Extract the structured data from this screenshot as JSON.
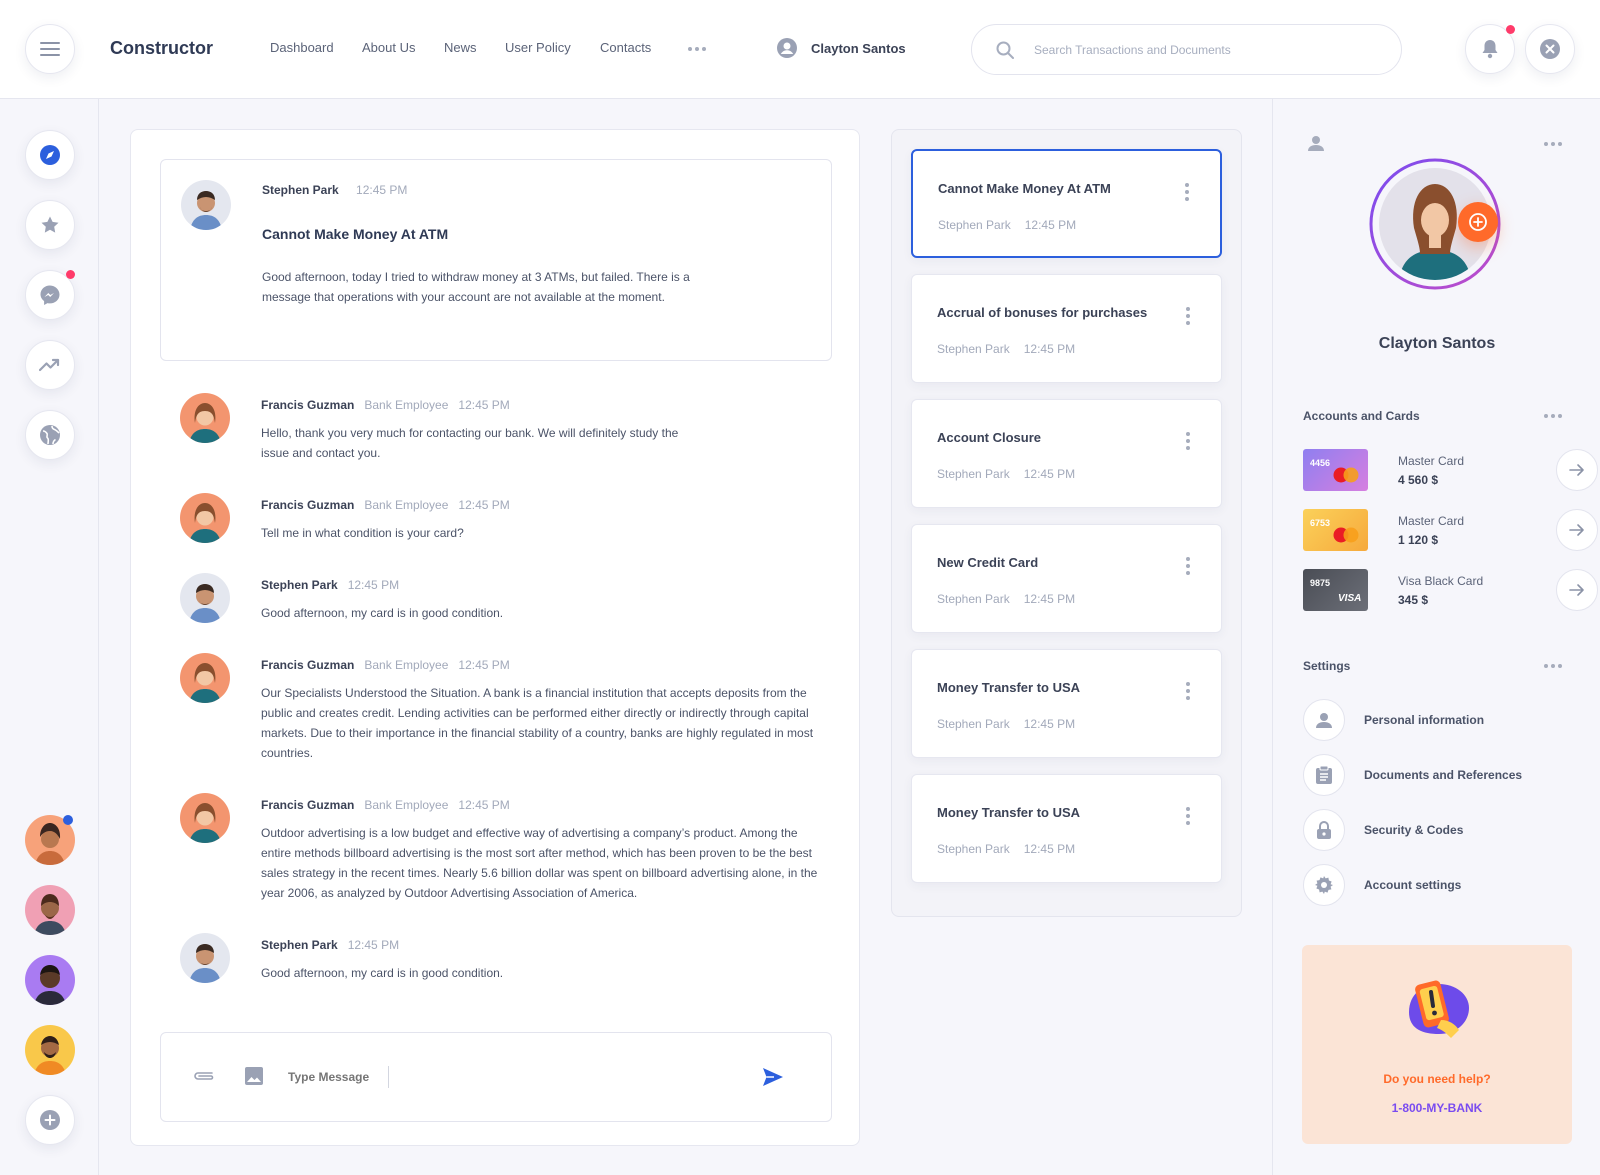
{
  "app": {
    "title": "Constructor"
  },
  "nav": {
    "items": [
      {
        "label": "Dashboard"
      },
      {
        "label": "About Us"
      },
      {
        "label": "News"
      },
      {
        "label": "User Policy"
      },
      {
        "label": "Contacts"
      }
    ]
  },
  "header": {
    "user_name": "Clayton Santos"
  },
  "search": {
    "placeholder": "Search Transactions and Documents",
    "value": ""
  },
  "conversation": {
    "subject": {
      "author": "Stephen Park",
      "time": "12:45 PM",
      "title": "Cannot Make Money At ATM",
      "text": "Good afternoon, today I tried to withdraw money at 3 ATMs, but failed. There is a message that operations with your account are not available at the moment."
    },
    "messages": [
      {
        "name": "Francis Guzman",
        "role": "Bank Employee",
        "time": "12:45 PM",
        "text": "Hello, thank you very much for contacting our bank. We will definitely study the issue and contact you."
      },
      {
        "name": "Francis Guzman",
        "role": "Bank Employee",
        "time": "12:45 PM",
        "text": "Tell me in what condition is your card?"
      },
      {
        "name": "Stephen Park",
        "role": "",
        "time": "12:45 PM",
        "text": "Good afternoon, my card is in good condition."
      },
      {
        "name": "Francis Guzman",
        "role": "Bank Employee",
        "time": "12:45 PM",
        "text": "Our Specialists Understood the Situation. A bank is a financial institution that accepts deposits from the public and creates credit. Lending activities can be performed either directly or indirectly through capital markets. Due to their importance in the financial stability of a country, banks are highly regulated in most countries."
      },
      {
        "name": "Francis Guzman",
        "role": "Bank Employee",
        "time": "12:45 PM",
        "text": "Outdoor advertising is a low budget and effective way of advertising a company’s product. Among the entire methods billboard advertising is the most sort after method, which has been proven to be the best sales strategy in the recent times. Nearly 5.6 billion dollar was spent on billboard advertising alone, in the year 2006, as analyzed by Outdoor Advertising Association of America."
      },
      {
        "name": "Stephen Park",
        "role": "",
        "time": "12:45 PM",
        "text": "Good afternoon, my card is in good condition."
      }
    ],
    "composer_placeholder": "Type Message"
  },
  "tickets": [
    {
      "title": "Cannot Make Money  At ATM",
      "author": "Stephen Park",
      "time": "12:45 PM",
      "active": true
    },
    {
      "title": "Accrual of bonuses for purchases",
      "author": "Stephen Park",
      "time": "12:45 PM"
    },
    {
      "title": "Account Closure",
      "author": "Stephen Park",
      "time": "12:45 PM"
    },
    {
      "title": "New Credit Card",
      "author": "Stephen Park",
      "time": "12:45 PM"
    },
    {
      "title": "Money Transfer to USA",
      "author": "Stephen Park",
      "time": "12:45 PM"
    },
    {
      "title": "Money Transfer to USA",
      "author": "Stephen Park",
      "time": "12:45 PM"
    }
  ],
  "profile": {
    "name": "Clayton Santos"
  },
  "accounts": {
    "title": "Accounts and Cards",
    "cards": [
      {
        "number": "4456",
        "name": "Master Card",
        "amount": "4 560 $",
        "brand": "mastercard",
        "color": "#8f7ff0"
      },
      {
        "number": "6753",
        "name": "Master Card",
        "amount": "1 120 $",
        "brand": "mastercard",
        "color": "#f8c64e"
      },
      {
        "number": "9875",
        "name": "Visa Black Card",
        "amount": "345 $",
        "brand": "VISA",
        "color": "#5b5e66"
      }
    ]
  },
  "settings": {
    "title": "Settings",
    "items": [
      {
        "label": "Personal information",
        "icon": "user-icon"
      },
      {
        "label": "Documents and References",
        "icon": "clipboard-icon"
      },
      {
        "label": "Security & Codes",
        "icon": "lock-icon"
      },
      {
        "label": "Account settings",
        "icon": "gear-icon"
      }
    ]
  },
  "help": {
    "question": "Do you need help?",
    "phone": "1-800-MY-BANK"
  },
  "colors": {
    "accent": "#2c5fdd",
    "orange": "#ff6a2a",
    "purple": "#7a4cf0",
    "notification": "#ff3b6a",
    "help_bg": "#fbe4d6"
  }
}
